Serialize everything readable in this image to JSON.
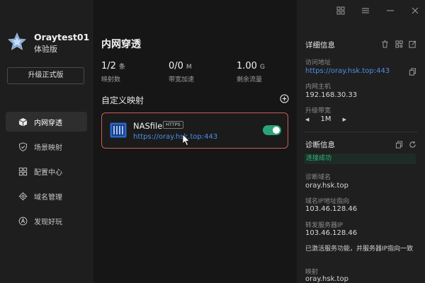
{
  "sidebar": {
    "profile": {
      "name": "Oraytest01",
      "plan": "体验版"
    },
    "upgrade_label": "升级正式版",
    "nav": [
      {
        "key": "intranet",
        "label": "内网穿透",
        "icon": "cube-icon",
        "active": true
      },
      {
        "key": "scene",
        "label": "场景映射",
        "icon": "shield-icon",
        "active": false
      },
      {
        "key": "config",
        "label": "配置中心",
        "icon": "grid-icon",
        "active": false
      },
      {
        "key": "domain",
        "label": "域名管理",
        "icon": "gear-icon",
        "active": false
      },
      {
        "key": "discover",
        "label": "发现好玩",
        "icon": "compass-icon",
        "active": false
      }
    ]
  },
  "main": {
    "title": "内网穿透",
    "stats": [
      {
        "value": "1/2",
        "unit": "条",
        "label": "映射数"
      },
      {
        "value": "0/0",
        "unit": "M",
        "label": "带宽加速"
      },
      {
        "value": "1.00",
        "unit": "G",
        "label": "剩余流量"
      }
    ],
    "section_title": "自定义映射",
    "mapping": {
      "name": "NASfile",
      "protocol": "HTTPS",
      "url": "https://oray.hsk.top:443",
      "enabled": true
    }
  },
  "right": {
    "detail_title": "详细信息",
    "access_label": "访问地址",
    "access_value": "https://oray.hsk.top:443",
    "intranet_host_label": "内网主机",
    "intranet_host_value": "192.168.30.33",
    "bandwidth_label": "升级带宽",
    "bandwidth_value": "1M",
    "diag_title": "诊断信息",
    "diag_status": "连接成功",
    "diag_domain_label": "诊断域名",
    "diag_domain_value": "oray.hsk.top",
    "domain_ip_label": "域名IP地址指向",
    "domain_ip_value": "103.46.128.46",
    "forward_label": "转发服务器IP",
    "forward_value": "103.46.128.46",
    "activate_note": "已激活服务功能，并服务器IP指向一致",
    "mapping_label": "映射",
    "mapping_value": "oray.hsk.top"
  },
  "colors": {
    "accent_green": "#2aa37b",
    "link_blue": "#4a8ee8",
    "highlight_border": "#c95d58"
  }
}
